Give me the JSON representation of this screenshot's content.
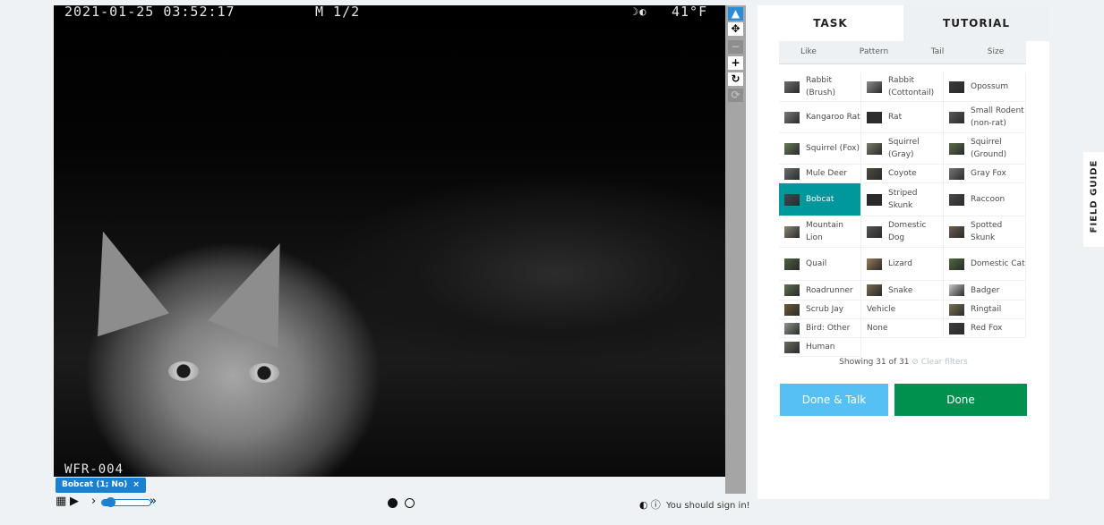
{
  "viewer": {
    "timestamp": "2021-01-25 03:52:17",
    "mode": "M 1/2",
    "moon": "☽◐",
    "temperature": "41°F",
    "camera_id": "WFR-004"
  },
  "toolbar": {
    "icons": [
      "pointer-icon",
      "move-icon",
      "zoom-out-icon",
      "zoom-in-icon",
      "rotate-icon",
      "reset-icon"
    ]
  },
  "annotation_tag": "Bobcat (1; No)",
  "playback": {
    "grid_icon": "▦",
    "play_icon": "▶",
    "step_left": "›",
    "step_right": "»",
    "speed_fraction": 0.15,
    "frame_dots": [
      "●",
      "○"
    ]
  },
  "status": {
    "sign_in_text": "You should sign in!"
  },
  "tabs": {
    "task": "TASK",
    "tutorial": "TUTORIAL"
  },
  "filters": [
    "Like",
    "Pattern",
    "Tail",
    "Size"
  ],
  "choices": [
    {
      "label": "Rabbit (Brush)",
      "two_line": true
    },
    {
      "label": "Rabbit (Cottontail)",
      "two_line": true
    },
    {
      "label": "Opossum"
    },
    {
      "label": "Kangaroo Rat",
      "two_line": true
    },
    {
      "label": "Rat"
    },
    {
      "label": "Small Rodent (non-rat)",
      "two_line": true
    },
    {
      "label": "Squirrel (Fox)",
      "two_line": true
    },
    {
      "label": "Squirrel (Gray)",
      "two_line": true
    },
    {
      "label": "Squirrel (Ground)",
      "two_line": true
    },
    {
      "label": "Mule Deer"
    },
    {
      "label": "Coyote"
    },
    {
      "label": "Gray Fox"
    },
    {
      "label": "Bobcat",
      "selected": true
    },
    {
      "label": "Striped Skunk",
      "two_line": true
    },
    {
      "label": "Raccoon"
    },
    {
      "label": "Mountain Lion",
      "two_line": true
    },
    {
      "label": "Domestic Dog",
      "two_line": true
    },
    {
      "label": "Spotted Skunk",
      "two_line": true
    },
    {
      "label": "Quail"
    },
    {
      "label": "Lizard"
    },
    {
      "label": "Domestic Cat",
      "two_line": true
    },
    {
      "label": "Roadrunner"
    },
    {
      "label": "Snake"
    },
    {
      "label": "Badger"
    },
    {
      "label": "Scrub Jay"
    },
    {
      "label": "Vehicle",
      "no_thumb": true
    },
    {
      "label": "Ringtail"
    },
    {
      "label": "Bird: Other"
    },
    {
      "label": "None",
      "no_thumb": true
    },
    {
      "label": "Red Fox"
    },
    {
      "label": "Human"
    }
  ],
  "showing_text": "Showing 31 of 31",
  "clear_filters": "⊘ Clear filters",
  "buttons": {
    "done_talk": "Done & Talk",
    "done": "Done"
  },
  "field_guide": "FIELD GUIDE"
}
